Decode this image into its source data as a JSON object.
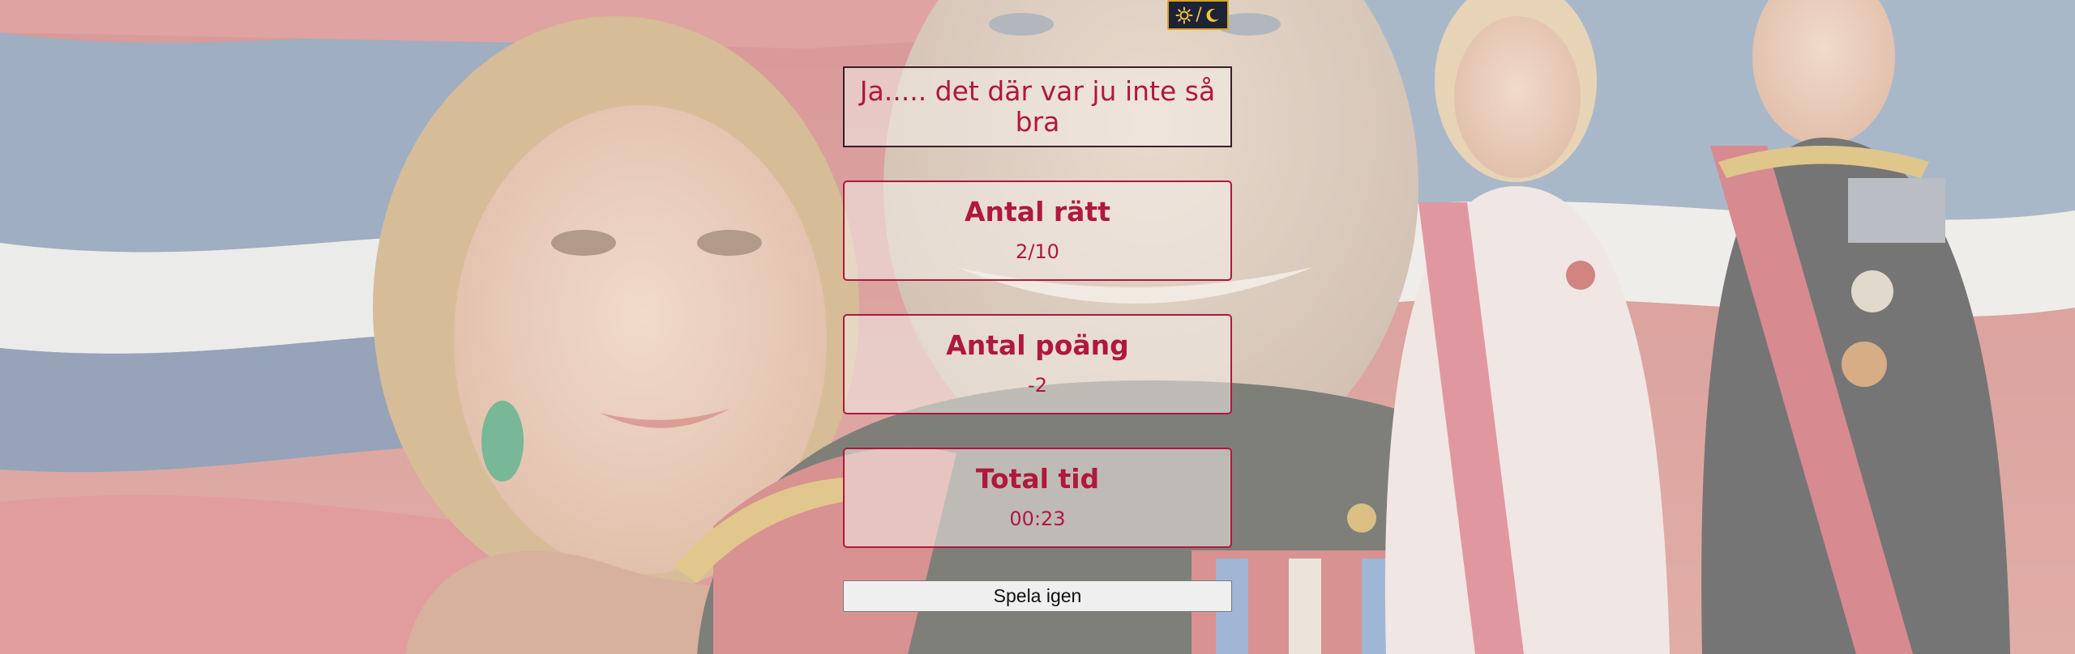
{
  "theme_toggle": {
    "sun_icon": "sun-icon",
    "separator": "/",
    "moon_icon": "moon-icon"
  },
  "result": {
    "message": "Ja..... det där var ju inte så bra"
  },
  "stats": [
    {
      "label": "Antal rätt",
      "value": "2/10"
    },
    {
      "label": "Antal poäng",
      "value": "-2"
    },
    {
      "label": "Total tid",
      "value": "00:23"
    }
  ],
  "actions": {
    "play_again": "Spela igen"
  },
  "colors": {
    "accent": "#b0183c",
    "toggle_bg": "#1d2336",
    "toggle_border": "#d9a620"
  }
}
